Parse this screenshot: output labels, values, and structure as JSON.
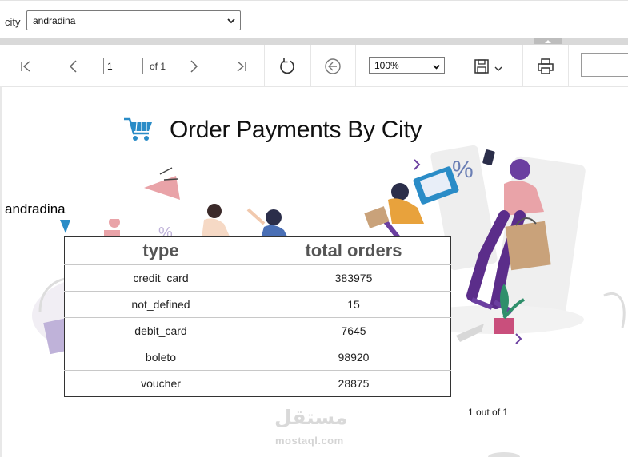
{
  "parameters": {
    "city_label": "city",
    "city_value": "andradina"
  },
  "toolbar": {
    "page_input": "1",
    "page_of": "of 1",
    "zoom": "100%",
    "icons": [
      "first-page-icon",
      "previous-page-icon",
      "next-page-icon",
      "last-page-icon",
      "refresh-icon",
      "back-icon",
      "save-icon",
      "chevron-down-icon",
      "print-icon"
    ]
  },
  "report": {
    "title": "Order Payments By City",
    "city_caption": "andradina",
    "table": {
      "headers": [
        "type",
        "total orders"
      ],
      "rows": [
        {
          "type": "credit_card",
          "total_orders": "383975"
        },
        {
          "type": "not_defined",
          "total_orders": "15"
        },
        {
          "type": "debit_card",
          "total_orders": "7645"
        },
        {
          "type": "boleto",
          "total_orders": "98920"
        },
        {
          "type": "voucher",
          "total_orders": "28875"
        }
      ]
    },
    "page_counter": "1 out of 1"
  },
  "watermark": {
    "arabic": "مستقل",
    "latin": "mostaql.com"
  },
  "colors": {
    "accent_blue": "#2a8cc7",
    "illustration_purple": "#6b3fa0",
    "illustration_pink": "#e9a3a8"
  }
}
